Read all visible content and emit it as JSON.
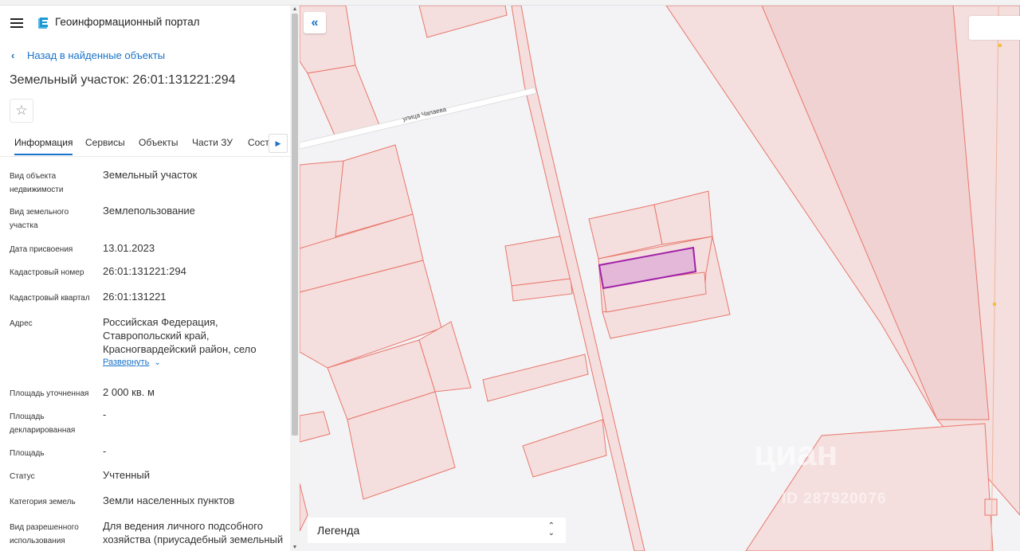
{
  "app": {
    "title": "Геоинформационный портал"
  },
  "nav": {
    "back_label": "Назад в найденные объекты"
  },
  "object": {
    "title": "Земельный участок: 26:01:131221:294"
  },
  "tabs": [
    {
      "label": "Информация"
    },
    {
      "label": "Сервисы"
    },
    {
      "label": "Объекты"
    },
    {
      "label": "Части ЗУ"
    },
    {
      "label": "Соста"
    }
  ],
  "details": [
    {
      "key": "Вид объекта недвижимости",
      "value": "Земельный участок"
    },
    {
      "key": "Вид земельного участка",
      "value": "Землепользование"
    },
    {
      "key": "Дата присвоения",
      "value": "13.01.2023"
    },
    {
      "key": "Кадастровый номер",
      "value": "26:01:131221:294"
    },
    {
      "key": "Кадастровый квартал",
      "value": "26:01:131221"
    },
    {
      "key": "Адрес",
      "value": "Российская Федерация, Ставропольский край, Красногвардейский район, село",
      "expand_label": "Развернуть"
    },
    {
      "key": "Площадь уточненная",
      "value": "2 000 кв. м"
    },
    {
      "key": "Площадь декларированная",
      "value": "-"
    },
    {
      "key": "Площадь",
      "value": "-"
    },
    {
      "key": "Статус",
      "value": "Учтенный"
    },
    {
      "key": "Категория земель",
      "value": "Земли населенных пунктов"
    },
    {
      "key": "Вид разрешенного использования",
      "value": "Для ведения личного подсобного хозяйства (приусадебный земельный участок)"
    }
  ],
  "map": {
    "street_label": "улица Чапаева",
    "legend_label": "Легенда",
    "watermark": "циан",
    "watermark_id": "ID 287920076",
    "colors": {
      "parcel_fill": "#f5dede",
      "parcel_stroke": "#e8776a",
      "selected_fill": "#e4b8d9",
      "selected_stroke": "#a020a8",
      "accent": "#1a73c9"
    }
  }
}
